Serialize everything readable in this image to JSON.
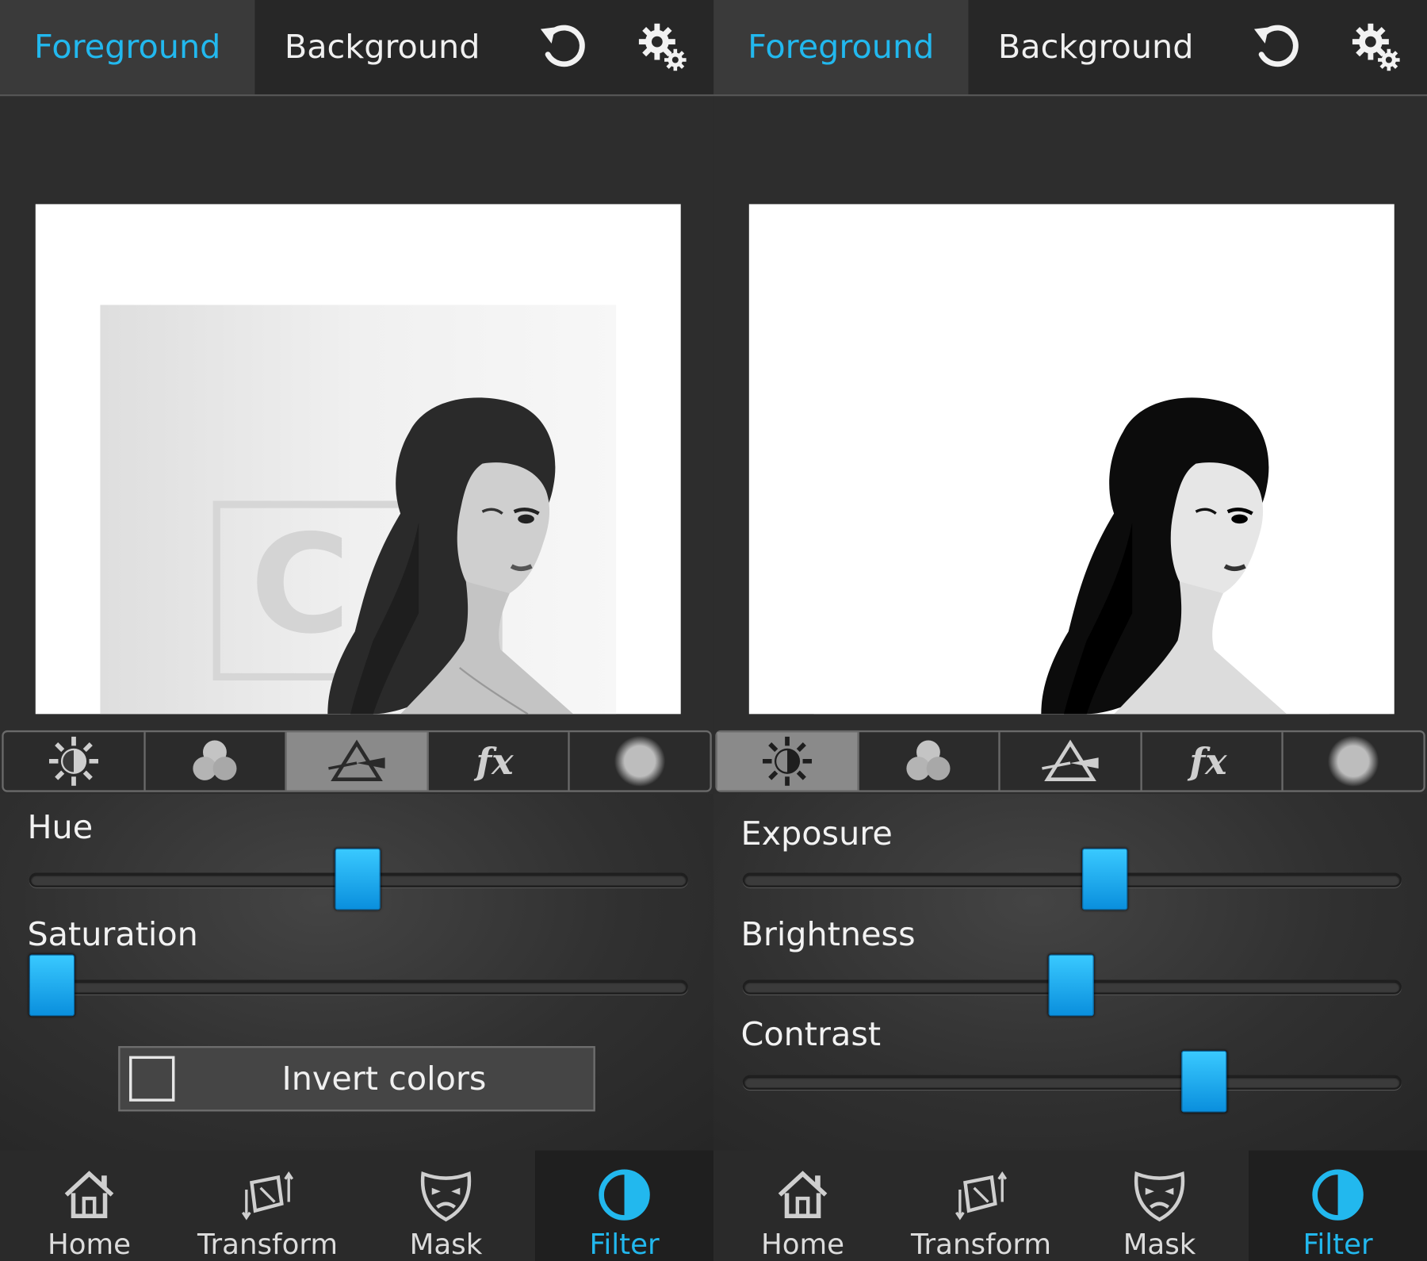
{
  "colors": {
    "accent": "#22b8ee",
    "slider_thumb": "#1aa8ee",
    "panel_bg": "#2d2d2d"
  },
  "left": {
    "tabs": {
      "foreground": "Foreground",
      "background": "Background",
      "active": "Foreground"
    },
    "tool_tabs": [
      "sun-icon",
      "circles-icon",
      "prism-icon",
      "fx-icon",
      "circle-icon"
    ],
    "active_tool": "prism-icon",
    "sliders": [
      {
        "label": "Hue",
        "value": 0.5
      },
      {
        "label": "Saturation",
        "value": 0.0
      }
    ],
    "invert_label": "Invert colors",
    "invert_checked": false,
    "photo_watermark": "C"
  },
  "right": {
    "tabs": {
      "foreground": "Foreground",
      "background": "Background",
      "active": "Foreground"
    },
    "tool_tabs": [
      "sun-icon",
      "circles-icon",
      "prism-icon",
      "fx-icon",
      "circle-icon"
    ],
    "active_tool": "sun-icon",
    "sliders": [
      {
        "label": "Exposure",
        "value": 0.555
      },
      {
        "label": "Brightness",
        "value": 0.5
      },
      {
        "label": "Contrast",
        "value": 0.718
      }
    ]
  },
  "nav": {
    "items": [
      {
        "label": "Home",
        "icon": "home-icon"
      },
      {
        "label": "Transform",
        "icon": "transform-icon"
      },
      {
        "label": "Mask",
        "icon": "mask-icon"
      },
      {
        "label": "Filter",
        "icon": "filter-icon"
      }
    ],
    "active": "Filter"
  }
}
